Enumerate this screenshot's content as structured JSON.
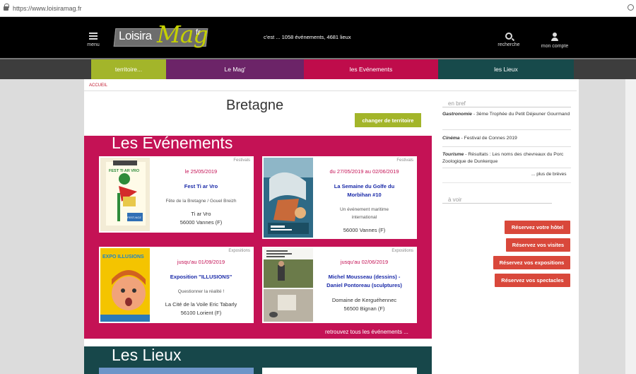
{
  "browser": {
    "url": "https://www.loisiramag.fr"
  },
  "header": {
    "menu_label": "menu",
    "logo": {
      "part1": "Loisira",
      "part2": "Mag",
      "part3": "fr"
    },
    "tagline": "c'est ... 1058 événements, 4681 lieux",
    "search_label": "recherche",
    "account_label": "mon compte"
  },
  "nav": {
    "items": [
      {
        "label": "territoire...",
        "color": "#a3b52a"
      },
      {
        "label": "Le Mag'",
        "color": "#6c2468"
      },
      {
        "label": "les Evénements",
        "color": "#bf0c4b"
      },
      {
        "label": "les Lieux",
        "color": "#174a4b"
      }
    ]
  },
  "breadcrumb": "ACCUEIL",
  "page": {
    "title": "Bretagne",
    "change_label": "changer de territoire"
  },
  "events": {
    "title": "Les Evénements",
    "see_all": "retrouvez tous les événements ...",
    "cards": [
      {
        "category": "Festivals",
        "date": "le 25/05/2019",
        "name": "Fest Ti ar Vro",
        "subtitle": "Fête de la Bretagne / Gouel Breizh",
        "venue": "Ti ar Vro",
        "city": "56000 Vannes (F)",
        "poster_text": "FEST TI AR VRO",
        "poster_sub": "FEST-NOZ"
      },
      {
        "category": "Festivals",
        "date": "du 27/05/2019 au 02/06/2019",
        "name_line1": "La Semaine du Golfe du",
        "name_line2": "Morbihan #10",
        "subtitle_line1": "Un événement maritime",
        "subtitle_line2": "international",
        "city": "56000 Vannes (F)"
      },
      {
        "category": "Expositions",
        "date": "jusqu'au 01/09/2019",
        "name": "Exposition \"ILLUSIONS\"",
        "subtitle": "Questionner la réalité !",
        "venue": "La Cité de la Voile Eric Tabarly",
        "city": "56100 Lorient (F)",
        "poster_text": "EXPO ILLUSIONS"
      },
      {
        "category": "Expositions",
        "date": "jusqu'au 02/06/2019",
        "name_line1": "Michel Mousseau (dessins) -",
        "name_line2": "Daniel Pontoreau (sculptures)",
        "venue": "Domaine de Kerguéhennec",
        "city": "56500 Bignan (F)"
      }
    ]
  },
  "places": {
    "title": "Les Lieux"
  },
  "sidebar": {
    "briefs_heading": "en bref",
    "briefs": [
      {
        "category": "Gastronomie",
        "text": " - 3ème Trophée du Petit Déjeuner Gourmand"
      },
      {
        "category": "Cinéma",
        "text": " - Festival de Connes 2019"
      },
      {
        "category": "Tourisme",
        "text": " - Résultats : Les noms des chevreaux du Porc Zoologique de Dunkerque"
      }
    ],
    "more_briefs": "... plus de brèves",
    "see_heading": "à voir",
    "buttons": [
      "Réservez votre hôtel",
      "Réservez vos visites",
      "Réservez vos expositions",
      "Réservez vos spectacles"
    ]
  }
}
